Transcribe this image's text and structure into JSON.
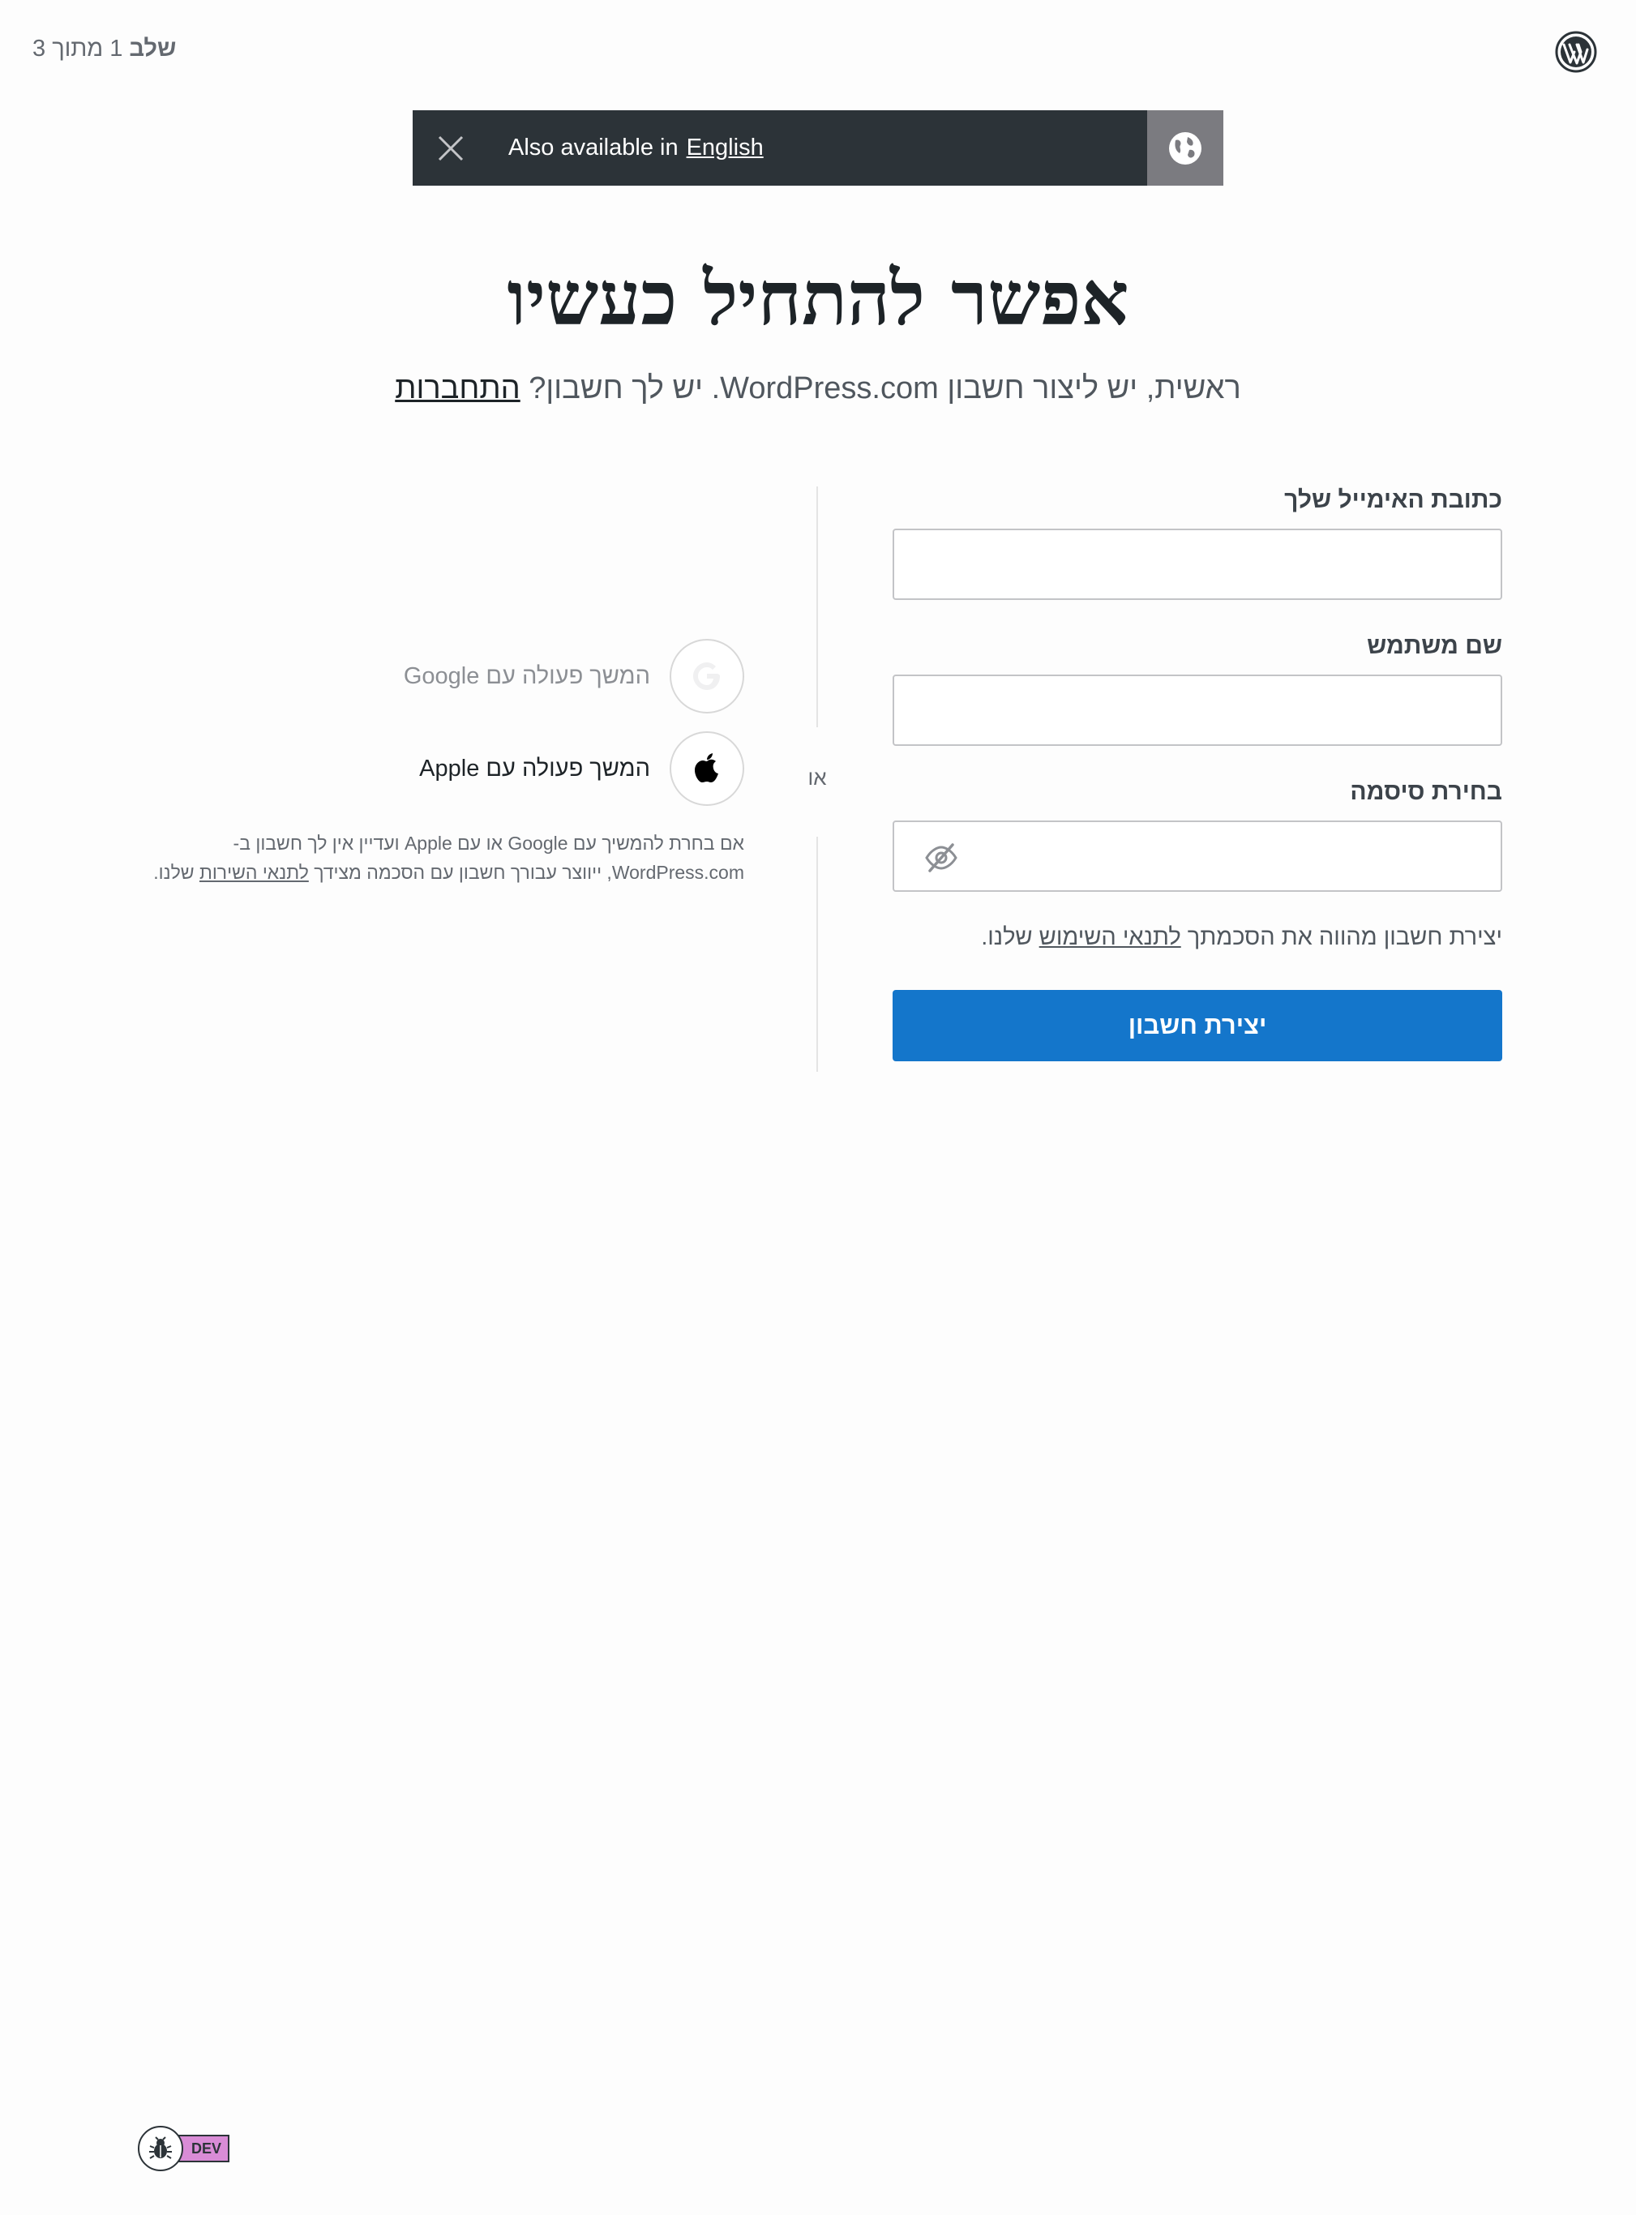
{
  "header": {
    "step": {
      "prefix": "שלב",
      "rest": "1 מתוך 3"
    }
  },
  "locale_banner": {
    "text": "Also available in",
    "link": "English"
  },
  "headline": "אפשר להתחיל כעשיו",
  "subheadline": {
    "text": "ראשית, יש ליצור חשבון WordPress.com. יש לך חשבון?",
    "login_link": "התחברות"
  },
  "form": {
    "email_label": "כתובת האימייל שלך",
    "email_value": "",
    "username_label": "שם משתמש",
    "username_value": "",
    "password_label": "בחירת סיסמה",
    "password_value": "",
    "tos_prefix": "יצירת חשבון מהווה את הסכמתך",
    "tos_link": "לתנאי השימוש",
    "tos_suffix": "שלנו.",
    "submit_label": "יצירת חשבון"
  },
  "divider": {
    "or": "או"
  },
  "social": {
    "google_label": "המשך פעולה עם Google",
    "apple_label": "המשך פעולה עם Apple",
    "note_prefix": "אם בחרת להמשיך עם Google או עם Apple ועדיין אין לך חשבון ב-WordPress.com, ייווצר עבורך חשבון עם הסכמה מצידך",
    "note_link": "לתנאי השירות",
    "note_suffix": "שלנו."
  },
  "dev_badge": {
    "label": "DEV"
  },
  "colors": {
    "primary_button": "#1476cb",
    "banner_bg": "#2c3338",
    "banner_globe_bg": "#7b7b80",
    "dev_tag": "#d98cd6"
  },
  "icons": [
    "wordpress-logo",
    "close-icon",
    "globe-icon",
    "eye-slash-icon",
    "google-icon",
    "apple-icon",
    "bug-icon"
  ]
}
